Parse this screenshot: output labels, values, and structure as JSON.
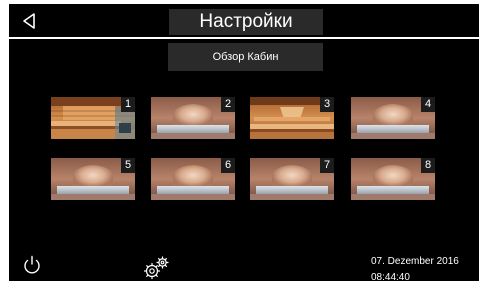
{
  "header": {
    "title": "Настройки",
    "back_icon": "back-triangle-icon"
  },
  "overview_button": {
    "label": "Обзор Кабин"
  },
  "cabins": [
    {
      "number": "1",
      "image": "wooden-sauna-photo"
    },
    {
      "number": "2",
      "image": "steam-room-photo"
    },
    {
      "number": "3",
      "image": "wooden-sauna-photo"
    },
    {
      "number": "4",
      "image": "steam-room-photo"
    },
    {
      "number": "5",
      "image": "steam-room-photo"
    },
    {
      "number": "6",
      "image": "steam-room-photo"
    },
    {
      "number": "7",
      "image": "steam-room-photo"
    },
    {
      "number": "8",
      "image": "steam-room-photo"
    }
  ],
  "footer": {
    "power_icon": "power-icon",
    "settings_icon": "gears-icon",
    "date": "07. Dezember 2016",
    "time": "08:44:40"
  },
  "colors": {
    "background": "#000000",
    "panel": "#2a2a2a",
    "text": "#ffffff",
    "steam_room_tone": "#b07a5e",
    "sauna_wood_tone": "#c8844a"
  }
}
